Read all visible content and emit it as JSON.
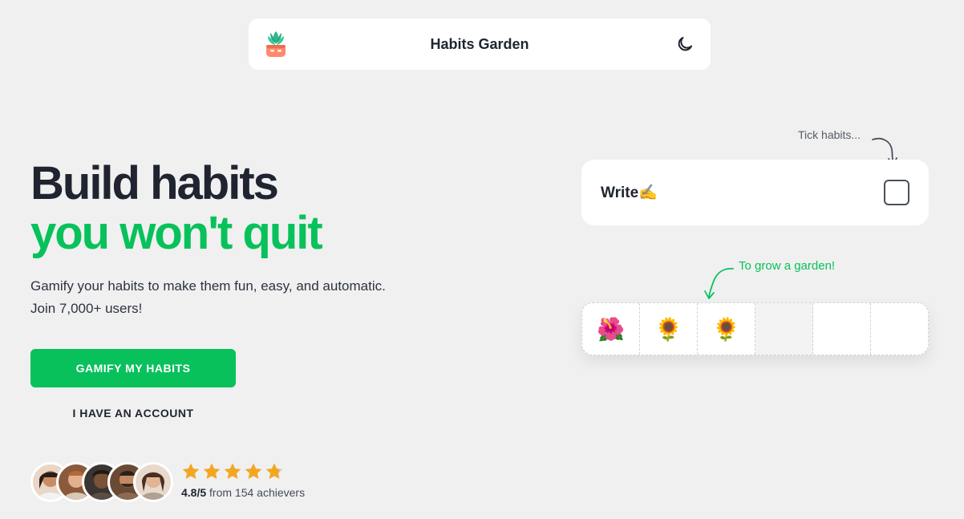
{
  "header": {
    "title": "Habits Garden",
    "logo_icon": "potted-plant-logo",
    "theme_icon": "moon-icon"
  },
  "hero": {
    "title_line1": "Build habits",
    "title_line2": "you won't quit",
    "subtitle_line1": "Gamify your habits to make them fun, easy, and automatic.",
    "subtitle_line2": "Join 7,000+ users!",
    "primary_cta": "GAMIFY MY HABITS",
    "secondary_cta": "I HAVE AN ACCOUNT"
  },
  "social_proof": {
    "rating": "4.8/5",
    "rating_suffix": " from 154 achievers",
    "stars": 4.8,
    "avatar_count": 5
  },
  "demo": {
    "tick_annotation": "Tick habits...",
    "habit_name": "Write✍️",
    "grow_annotation": "To grow a garden!",
    "garden_cells": [
      "🌺",
      "🌻",
      "🌻",
      "",
      "",
      ""
    ]
  },
  "colors": {
    "accent": "#08c15b",
    "background": "#f0f0f0",
    "text": "#1f2430",
    "star": "#f4a623"
  }
}
